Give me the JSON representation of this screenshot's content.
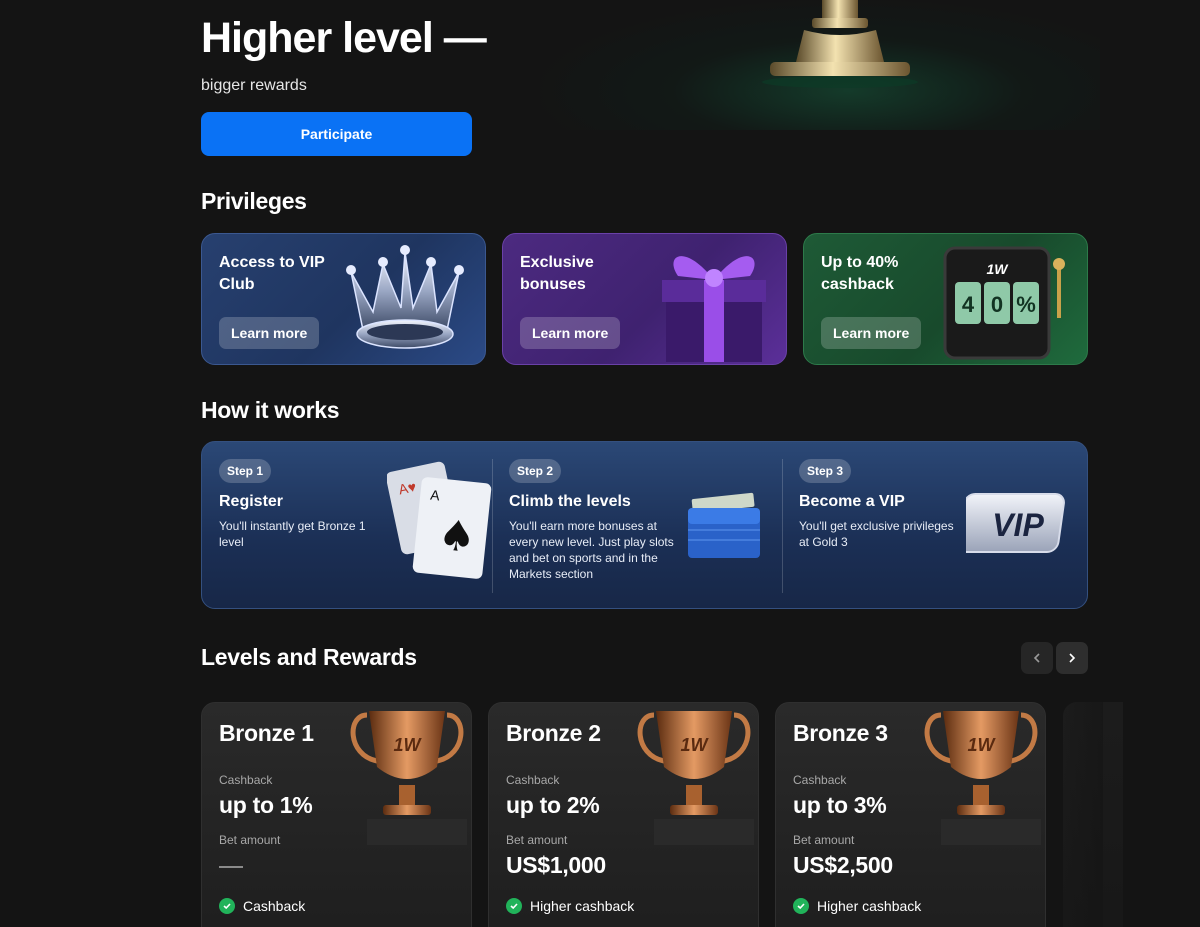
{
  "hero": {
    "title": "Higher level —",
    "subtitle": "bigger rewards",
    "cta_label": "Participate"
  },
  "privileges": {
    "title": "Privileges",
    "cards": [
      {
        "title": "Access to VIP Club",
        "button": "Learn more",
        "art": "crown-icon"
      },
      {
        "title": "Exclusive bonuses",
        "button": "Learn more",
        "art": "gift-icon"
      },
      {
        "title": "Up to 40% cashback",
        "button": "Learn more",
        "art": "slot-machine-icon",
        "slot_brand": "1W",
        "slot_reels": [
          "4",
          "0",
          "%"
        ]
      }
    ]
  },
  "how_it_works": {
    "title": "How it works",
    "steps": [
      {
        "badge": "Step 1",
        "title": "Register",
        "desc": "You'll instantly get Bronze 1 level",
        "art": "playing-cards-icon"
      },
      {
        "badge": "Step 2",
        "title": "Climb the levels",
        "desc": "You'll earn more bonuses at every new level. Just play slots and bet on sports and in the Markets section",
        "art": "wallet-icon"
      },
      {
        "badge": "Step 3",
        "title": "Become a VIP",
        "desc": "You'll get exclusive privileges at Gold 3",
        "art": "vip-badge-icon",
        "art_text": "VIP"
      }
    ]
  },
  "levels": {
    "title": "Levels and Rewards",
    "cashback_label": "Cashback",
    "bet_label": "Bet amount",
    "cup_brand": "1W",
    "cards": [
      {
        "name": "Bronze 1",
        "cashback": "up to 1%",
        "bet": "—",
        "feature": "Cashback"
      },
      {
        "name": "Bronze 2",
        "cashback": "up to 2%",
        "bet": "US$1,000",
        "feature": "Higher cashback"
      },
      {
        "name": "Bronze 3",
        "cashback": "up to 3%",
        "bet": "US$2,500",
        "feature": "Higher cashback"
      }
    ]
  },
  "colors": {
    "background": "#141414",
    "primary_button": "#0a72f5",
    "check_green": "#21b35a"
  }
}
